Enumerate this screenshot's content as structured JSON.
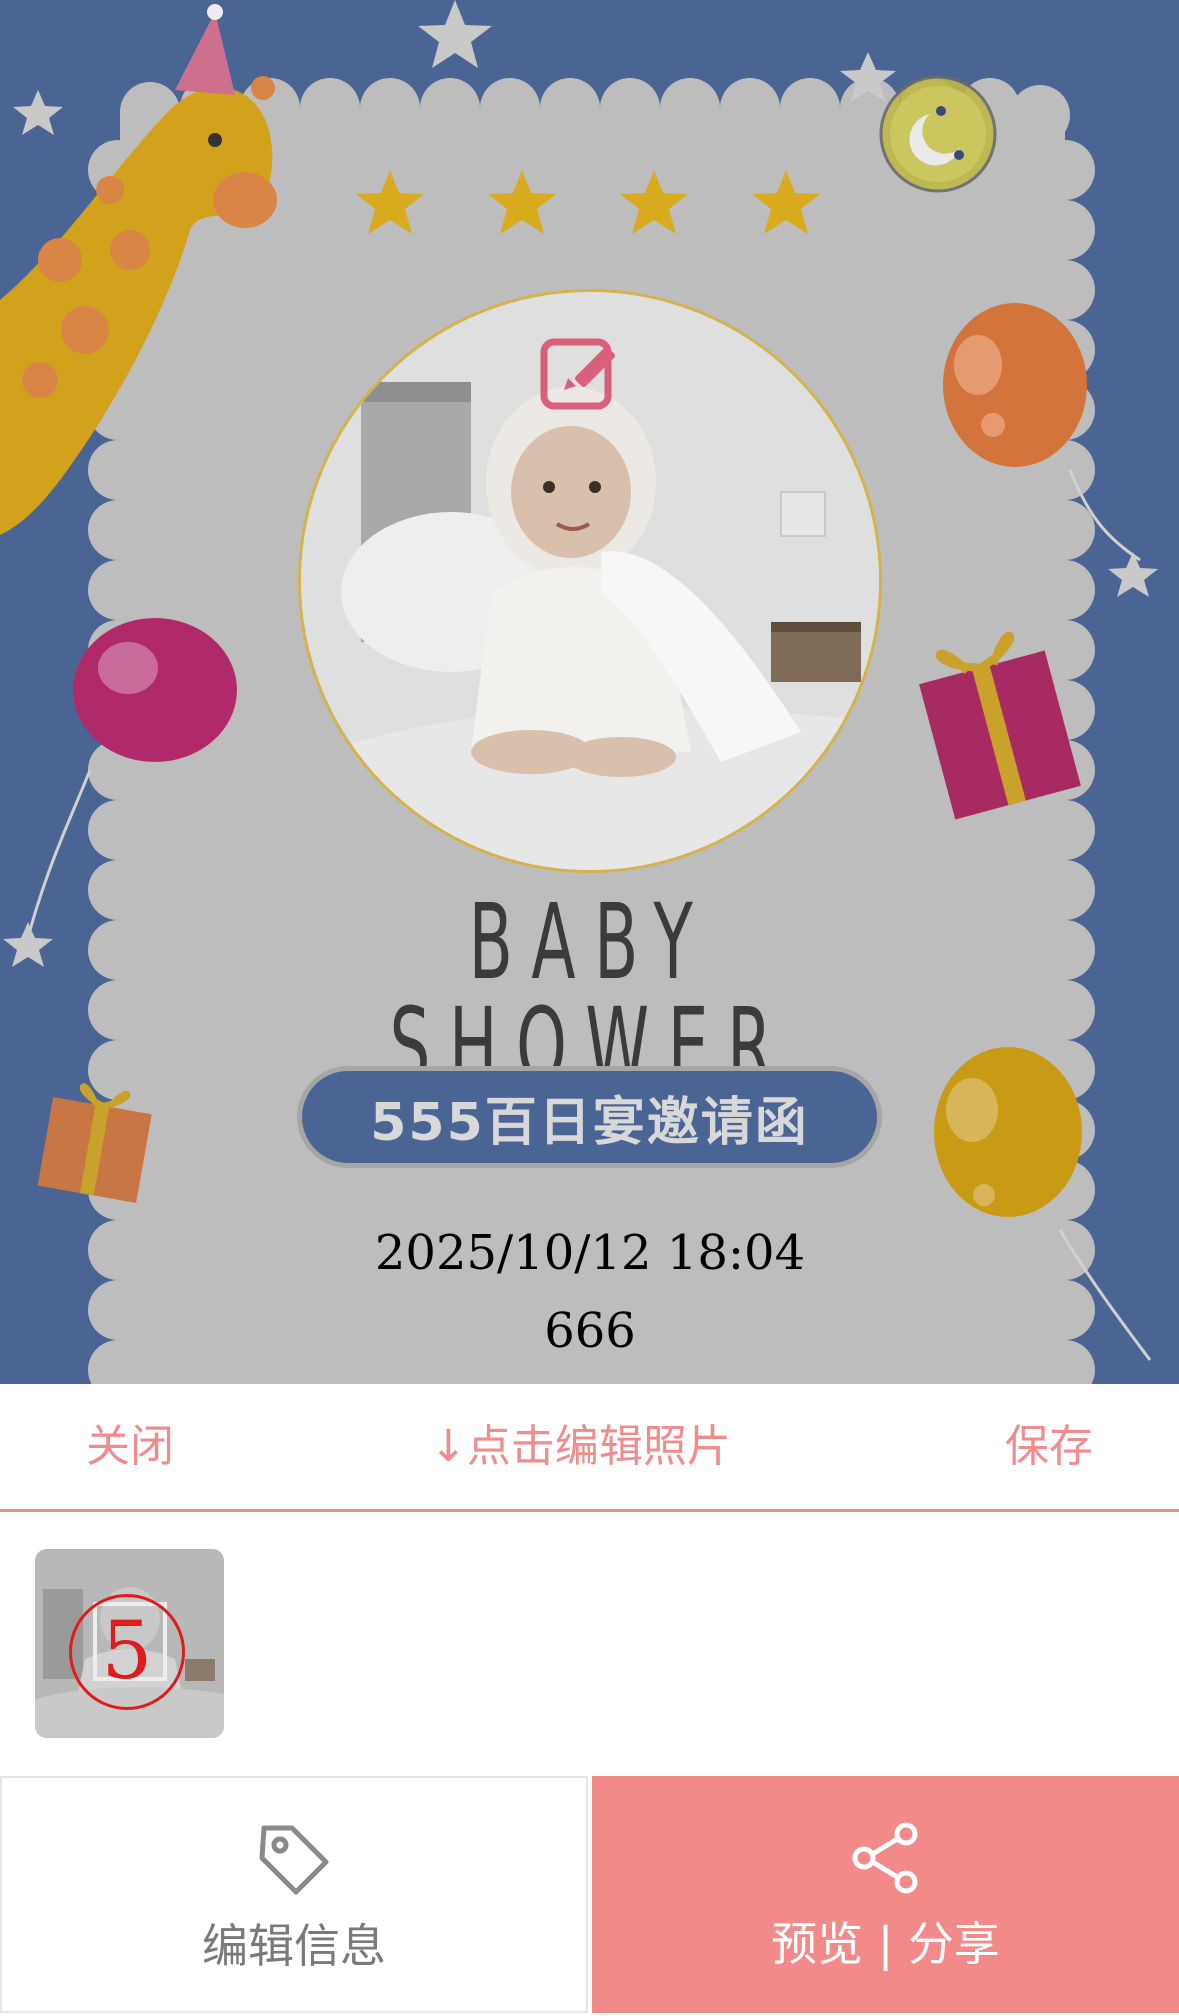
{
  "card": {
    "headline": "BABY SHOWER",
    "title": "555百日宴邀请函",
    "datetime": "2025/10/12 18:04",
    "extra": "666"
  },
  "toolbar": {
    "close_label": "关闭",
    "hint_label": "↓点击编辑照片",
    "save_label": "保存"
  },
  "thumbnails": [
    {
      "number": "5"
    }
  ],
  "bottom_bar": {
    "edit_info_label": "编辑信息",
    "share_label": "预览 | 分享"
  },
  "icons": {
    "edit_photo": "edit-square-icon",
    "music": "music-disc-icon",
    "edit_info": "tag-icon",
    "share": "share-icon"
  },
  "colors": {
    "accent": "#f08c8c",
    "share_bg": "#f28a8a",
    "card_bg": "#4a6494",
    "card_paper": "#bdbdbd"
  }
}
